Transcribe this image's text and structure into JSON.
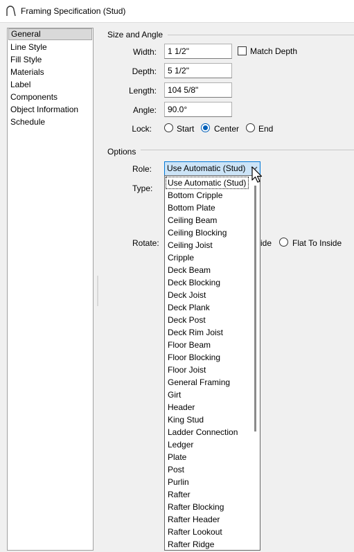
{
  "window": {
    "title": "Framing Specification (Stud)"
  },
  "sidebar": {
    "items": [
      {
        "label": "General",
        "selected": true
      },
      {
        "label": "Line Style"
      },
      {
        "label": "Fill Style"
      },
      {
        "label": "Materials"
      },
      {
        "label": "Label"
      },
      {
        "label": "Components"
      },
      {
        "label": "Object Information"
      },
      {
        "label": "Schedule"
      }
    ]
  },
  "size_and_angle": {
    "group_label": "Size and Angle",
    "width": {
      "label": "Width:",
      "value": "1 1/2\""
    },
    "match_depth": {
      "label": "Match Depth",
      "checked": false
    },
    "depth": {
      "label": "Depth:",
      "value": "5 1/2\""
    },
    "length": {
      "label": "Length:",
      "value": "104 5/8\""
    },
    "angle": {
      "label": "Angle:",
      "value": "90.0°"
    },
    "lock": {
      "label": "Lock:",
      "options": [
        {
          "label": "Start",
          "checked": false
        },
        {
          "label": "Center",
          "checked": true
        },
        {
          "label": "End",
          "checked": false
        }
      ]
    }
  },
  "options": {
    "group_label": "Options",
    "role": {
      "label": "Role:",
      "value": "Use Automatic (Stud)"
    },
    "type": {
      "label": "Type:"
    },
    "rotate": {
      "label": "Rotate:",
      "partial_option": "ide",
      "option": {
        "label": "Flat To Inside",
        "checked": false
      }
    }
  },
  "role_dropdown": {
    "items": [
      "Use Automatic (Stud)",
      "Bottom Cripple",
      "Bottom Plate",
      "Ceiling Beam",
      "Ceiling Blocking",
      "Ceiling Joist",
      "Cripple",
      "Deck Beam",
      "Deck Blocking",
      "Deck Joist",
      "Deck Plank",
      "Deck Post",
      "Deck Rim Joist",
      "Floor Beam",
      "Floor Blocking",
      "Floor Joist",
      "General Framing",
      "Girt",
      "Header",
      "King Stud",
      "Ladder Connection",
      "Ledger",
      "Plate",
      "Post",
      "Purlin",
      "Rafter",
      "Rafter Blocking",
      "Rafter Header",
      "Rafter Lookout",
      "Rafter Ridge"
    ],
    "highlighted_index": 0
  },
  "colors": {
    "accent": "#0078d7",
    "selection": "#cce4f7",
    "radio_fill": "#005fb8"
  }
}
